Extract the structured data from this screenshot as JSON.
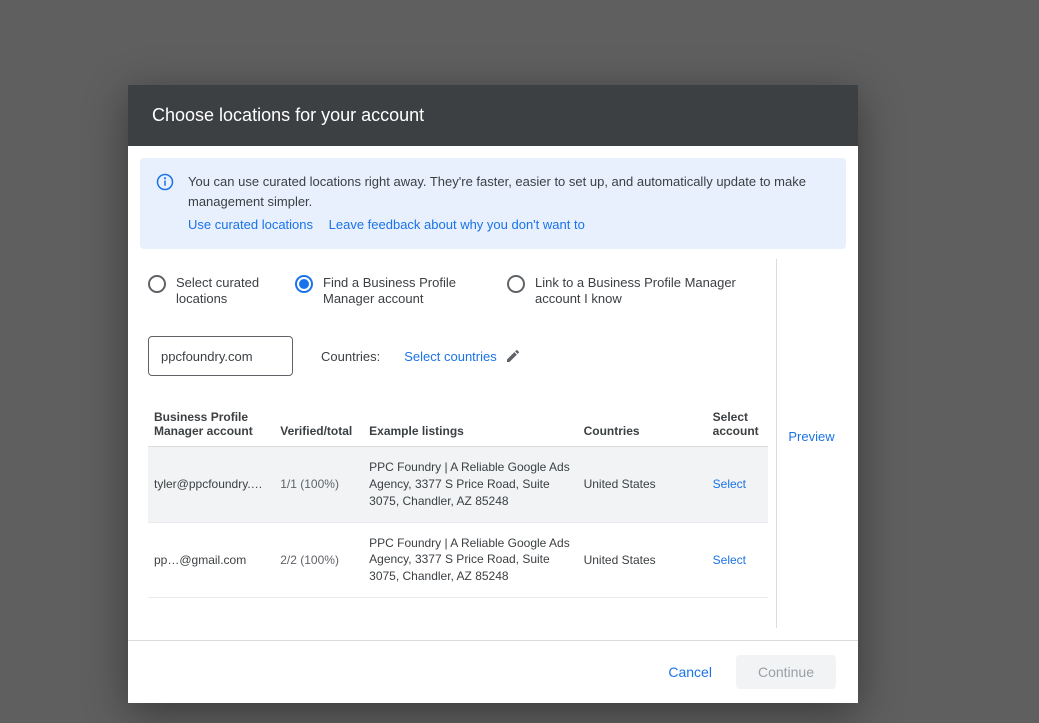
{
  "dialog": {
    "title": "Choose locations for your account"
  },
  "banner": {
    "text": "You can use curated locations right away. They're faster, easier to set up, and automatically update to make management simpler.",
    "link1": "Use curated locations",
    "link2": "Leave feedback about why you don't want to"
  },
  "radios": {
    "opt1": "Select curated locations",
    "opt2": "Find a Business Profile Manager account",
    "opt3": "Link to a Business Profile Manager account I know"
  },
  "search": {
    "value": "ppcfoundry.com"
  },
  "countries": {
    "label": "Countries:",
    "link": "Select countries"
  },
  "table": {
    "headers": {
      "account": "Business Profile Manager account",
      "verified": "Verified/total",
      "listings": "Example listings",
      "countries": "Countries",
      "select": "Select account"
    },
    "rows": [
      {
        "account": "tyler@ppcfoundry.…",
        "verified": "1/1 (100%)",
        "listing": "PPC Foundry | A Reliable Google Ads Agency, 3377 S Price Road, Suite 3075, Chandler, AZ 85248",
        "country": "United States",
        "select": "Select"
      },
      {
        "account": "pp…@gmail.com",
        "verified": "2/2 (100%)",
        "listing": "PPC Foundry | A Reliable Google Ads Agency, 3377 S Price Road, Suite 3075, Chandler, AZ 85248",
        "country": "United States",
        "select": "Select"
      }
    ]
  },
  "preview": "Preview",
  "footer": {
    "cancel": "Cancel",
    "continue": "Continue"
  }
}
